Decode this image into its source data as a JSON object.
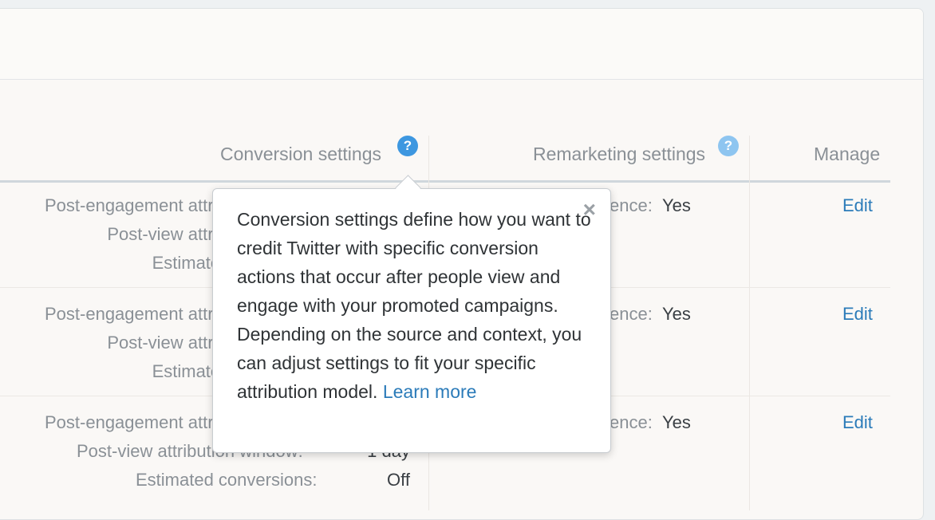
{
  "columns": {
    "conversion": "Conversion settings",
    "remarketing": "Remarketing settings",
    "manage": "Manage"
  },
  "help_icon_glyph": "?",
  "rows": [
    {
      "post_engagement_label": "Post-engagement attribution window:",
      "post_view_label": "Post-view attribution window:",
      "estimated_label": "Estimated conversions:",
      "audience_label": "Audience:",
      "audience_value": "Yes",
      "edit_label": "Edit"
    },
    {
      "post_engagement_label": "Post-engagement attribution window:",
      "post_view_label": "Post-view attribution window:",
      "estimated_label": "Estimated conversions:",
      "audience_label": "Audience:",
      "audience_value": "Yes",
      "edit_label": "Edit"
    },
    {
      "post_engagement_label": "Post-engagement attribution window:",
      "post_view_label": "Post-view attribution window:",
      "post_view_value": "1 day",
      "estimated_label": "Estimated conversions:",
      "estimated_value": "Off",
      "audience_label": "Audience:",
      "audience_value": "Yes",
      "edit_label": "Edit"
    }
  ],
  "tooltip": {
    "text": "Conversion settings define how you want to credit Twitter with specific conversion actions that occur after people view and engage with your promoted campaigns. Depending on the source and context, you can adjust settings to fit your specific attribution model.",
    "link": "Learn more",
    "close": "×"
  }
}
